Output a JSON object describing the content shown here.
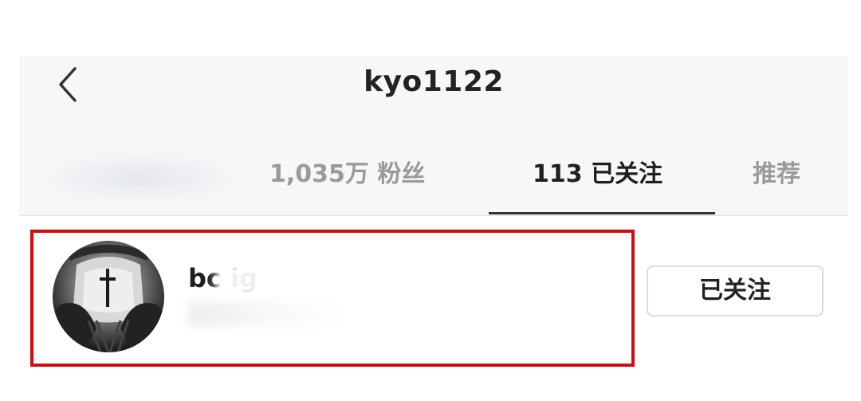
{
  "header": {
    "title": "kyo1122",
    "back_icon": "chevron-left-icon"
  },
  "tabs": [
    {
      "label": "1,035万 粉丝",
      "active": false
    },
    {
      "label": "113 已关注",
      "active": true
    },
    {
      "label": "推荐",
      "active": false
    }
  ],
  "following_list": {
    "items": [
      {
        "username": "bc            ig",
        "follow_button_label": "已关注"
      }
    ]
  },
  "colors": {
    "header_bg": "#f7f7f7",
    "title_text": "#222222",
    "inactive_tab": "#9a9a9a",
    "active_tab": "#1f1f1f",
    "highlight_border": "#d10a10",
    "button_border": "#dcdcdc"
  }
}
